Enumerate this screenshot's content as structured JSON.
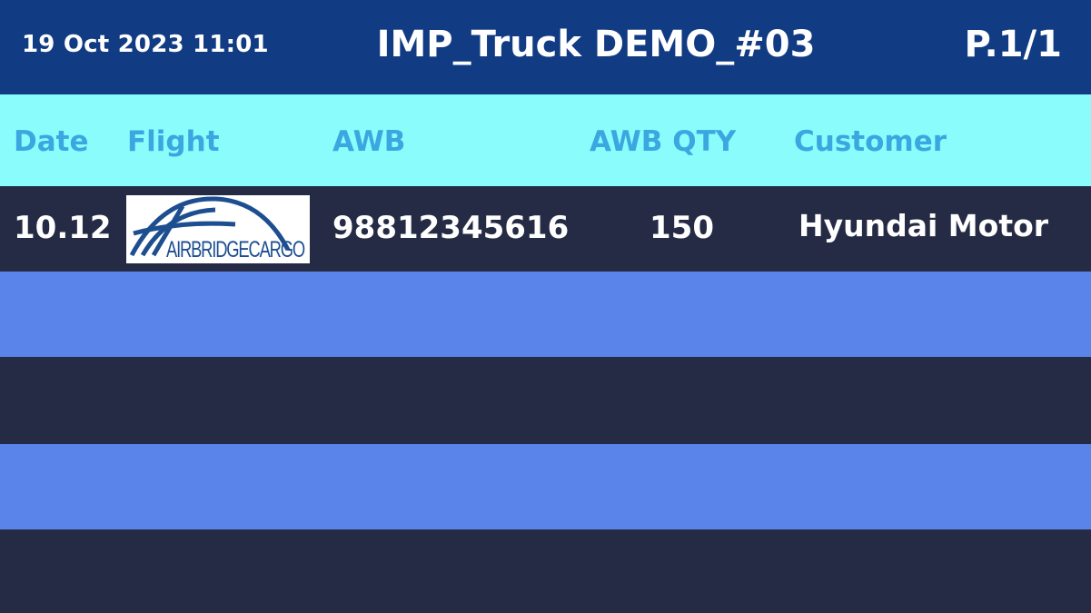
{
  "header": {
    "datetime": "19 Oct 2023 11:01",
    "title": "IMP_Truck DEMO_#03",
    "page": "P.1/1"
  },
  "columns": {
    "date": "Date",
    "flight": "Flight",
    "awb": "AWB",
    "awb_qty": "AWB QTY",
    "customer": "Customer"
  },
  "rows": [
    {
      "date": "10.12",
      "flight_logo": "airbridgecargo-logo",
      "flight_logo_text": "AIRBRIDGECARGO",
      "awb": "98812345616",
      "awb_qty": "150",
      "customer": "Hyundai Motor"
    }
  ],
  "colors": {
    "header_bg": "#113b82",
    "column_header_bg": "#8bfcfc",
    "column_header_text": "#3aa7e0",
    "row_dark": "#252b45",
    "row_blue": "#5a84e9",
    "logo_blue": "#1d4e8f"
  }
}
